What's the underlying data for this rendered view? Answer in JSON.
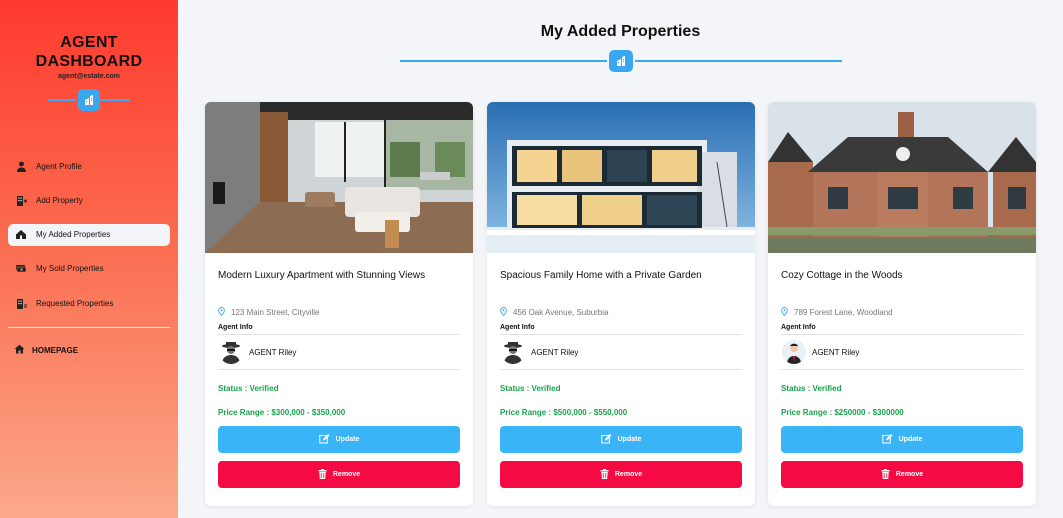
{
  "sidebar": {
    "title_line1": "AGENT",
    "title_line2": "DASHBOARD",
    "email": "agent@estate.com",
    "items": [
      {
        "label": "Agent Profile",
        "icon": "user-tie-icon"
      },
      {
        "label": "Add Property",
        "icon": "building-plus-icon"
      },
      {
        "label": "My Added Properties",
        "icon": "house-icon",
        "active": true
      },
      {
        "label": "My Sold Properties",
        "icon": "money-stack-icon"
      },
      {
        "label": "Requested Properties",
        "icon": "building-list-icon"
      }
    ],
    "homepage": "HOMEPAGE"
  },
  "main": {
    "title": "My Added Properties",
    "update_label": "Update",
    "remove_label": "Remove",
    "agent_info_label": "Agent Info",
    "cards": [
      {
        "name": "Modern Luxury Apartment with Stunning Views",
        "address": "123 Main Street, Cityville",
        "agent": "AGENT Riley",
        "status": "Status : Verified",
        "price": "Price Range : $300,000 - $350,000"
      },
      {
        "name": "Spacious Family Home with a Private Garden",
        "address": "456 Oak Avenue, Suburbia",
        "agent": "AGENT Riley",
        "status": "Status : Verified",
        "price": "Price Range : $500,000 - $550,000"
      },
      {
        "name": "Cozy Cottage in the Woods",
        "address": "789 Forest Lane, Woodland",
        "agent": "AGENT Riley",
        "status": "Status : Verified",
        "price": "Price Range : $250000 - $300000"
      }
    ]
  },
  "colors": {
    "accent": "#38a7ef",
    "update": "#38b4f7",
    "remove": "#f50a43",
    "status": "#17a34a",
    "sidebar_top": "#ff3a2e",
    "sidebar_bottom": "#fba98a"
  }
}
